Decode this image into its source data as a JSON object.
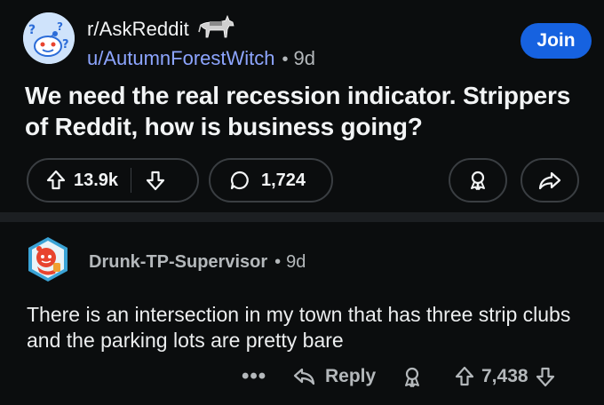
{
  "post": {
    "subreddit": "r/AskReddit",
    "author": "u/AutumnForestWitch",
    "separator": "•",
    "age": "9d",
    "join_label": "Join",
    "title": "We need the real recession indicator. Strippers of Reddit, how is business going?",
    "upvotes": "13.9k",
    "comments": "1,724"
  },
  "comment": {
    "author": "Drunk-TP-Supervisor",
    "separator": "•",
    "age": "9d",
    "body": "There is an intersection in my town that has three strip clubs and the parking lots are pretty bare",
    "more_label": "•••",
    "reply_label": "Reply",
    "score": "7,438"
  },
  "colors": {
    "background": "#0b0d0e",
    "join_button": "#1662e0",
    "author_link": "#8da5ff",
    "muted_text": "#b4b8bb"
  },
  "icons": {
    "subreddit_avatar": "askreddit-snoo-icon",
    "subreddit_badge": "donkey-icon",
    "upvote": "arrow-up-icon",
    "downvote": "arrow-down-icon",
    "comment": "speech-bubble-icon",
    "award": "award-ribbon-icon",
    "share": "share-arrow-icon",
    "reply": "reply-arrow-icon",
    "commenter_avatar": "snoo-avatar-icon"
  }
}
